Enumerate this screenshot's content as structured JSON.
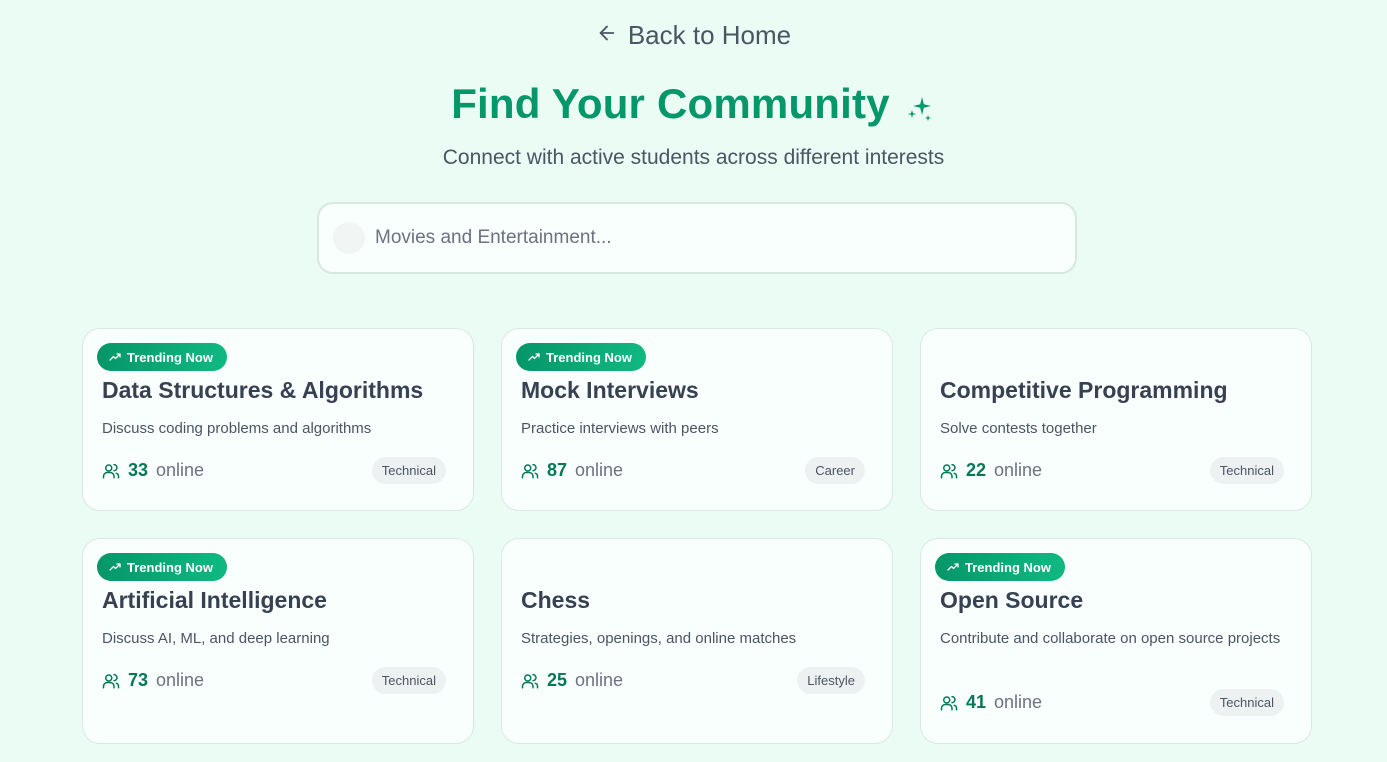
{
  "nav": {
    "back_label": "Back to Home"
  },
  "header": {
    "title": "Find Your Community",
    "subtitle": "Connect with active students across different interests"
  },
  "search": {
    "placeholder": "Movies and Entertainment..."
  },
  "colors": {
    "accent": "#059669",
    "badge_end": "#10b981",
    "background": "#ebfcf4",
    "card_bg": "#f8fffd"
  },
  "online_suffix": "online",
  "trending_label": "Trending Now",
  "communities": [
    {
      "title": "Data Structures & Algorithms",
      "description": "Discuss coding problems and algorithms",
      "online": "33",
      "category": "Technical",
      "trending": true
    },
    {
      "title": "Mock Interviews",
      "description": "Practice interviews with peers",
      "online": "87",
      "category": "Career",
      "trending": true
    },
    {
      "title": "Competitive Programming",
      "description": "Solve contests together",
      "online": "22",
      "category": "Technical",
      "trending": false
    },
    {
      "title": "Artificial Intelligence",
      "description": "Discuss AI, ML, and deep learning",
      "online": "73",
      "category": "Technical",
      "trending": true
    },
    {
      "title": "Chess",
      "description": "Strategies, openings, and online matches",
      "online": "25",
      "category": "Lifestyle",
      "trending": false
    },
    {
      "title": "Open Source",
      "description": "Contribute and collaborate on open source projects",
      "online": "41",
      "category": "Technical",
      "trending": true
    }
  ]
}
